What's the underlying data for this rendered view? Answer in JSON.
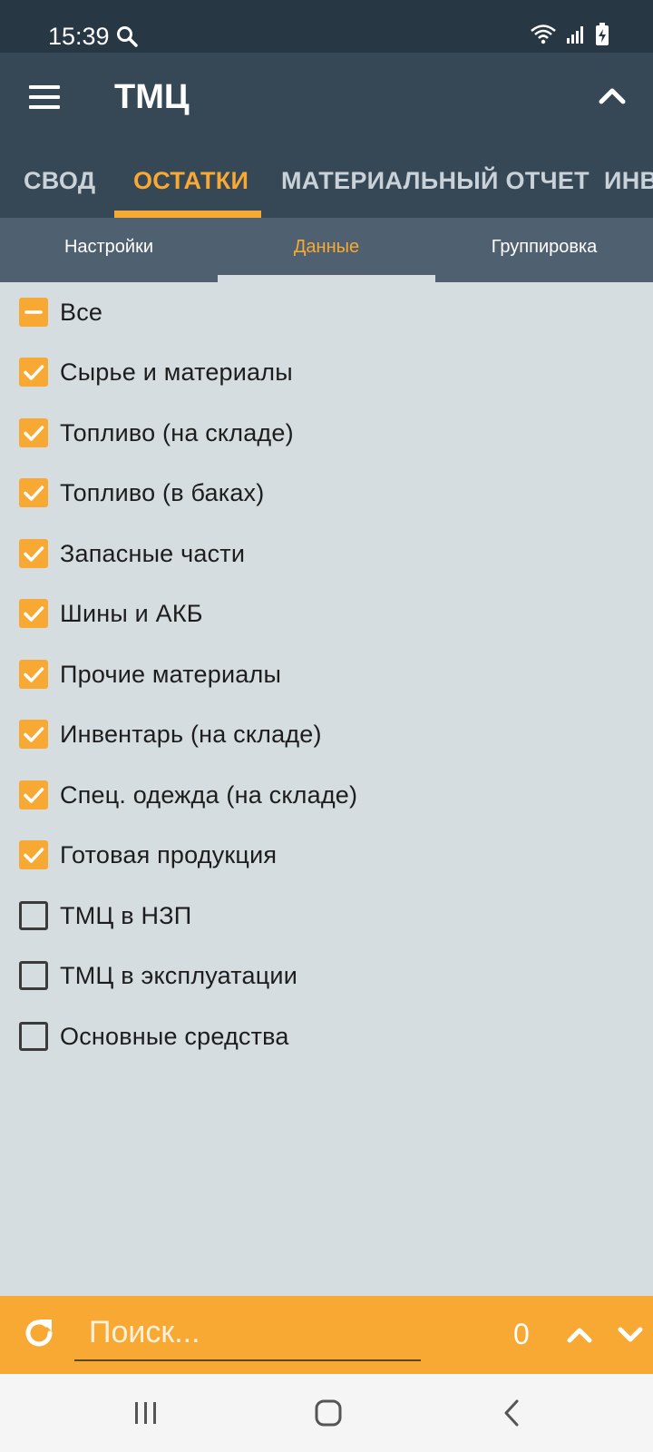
{
  "status_bar": {
    "time": "15:39"
  },
  "app_bar": {
    "title": "ТМЦ"
  },
  "tabs": [
    {
      "label": "СВОД",
      "active": false
    },
    {
      "label": "ОСТАТКИ",
      "active": true
    },
    {
      "label": "МАТЕРИАЛЬНЫЙ ОТЧЕТ",
      "active": false
    },
    {
      "label": "ИНВ",
      "active": false
    }
  ],
  "subtabs": [
    {
      "label": "Настройки",
      "active": false
    },
    {
      "label": "Данные",
      "active": true
    },
    {
      "label": "Группировка",
      "active": false
    }
  ],
  "items": [
    {
      "label": "Все",
      "state": "partial"
    },
    {
      "label": "Сырье и материалы",
      "state": "checked"
    },
    {
      "label": "Топливо (на складе)",
      "state": "checked"
    },
    {
      "label": "Топливо (в баках)",
      "state": "checked"
    },
    {
      "label": "Запасные части",
      "state": "checked"
    },
    {
      "label": "Шины и АКБ",
      "state": "checked"
    },
    {
      "label": "Прочие материалы",
      "state": "checked"
    },
    {
      "label": "Инвентарь (на складе)",
      "state": "checked"
    },
    {
      "label": "Спец. одежда (на складе)",
      "state": "checked"
    },
    {
      "label": "Готовая продукция",
      "state": "checked"
    },
    {
      "label": "ТМЦ в НЗП",
      "state": "unchecked"
    },
    {
      "label": "ТМЦ в эксплуатации",
      "state": "unchecked"
    },
    {
      "label": "Основные средства",
      "state": "unchecked"
    }
  ],
  "search": {
    "placeholder": "Поиск...",
    "value": "",
    "count": "0"
  },
  "colors": {
    "accent": "#f7a933",
    "bar_dark": "#364756",
    "status_dark": "#283744",
    "subtab_bg": "#4f6170",
    "content_bg": "#d5dde1"
  }
}
